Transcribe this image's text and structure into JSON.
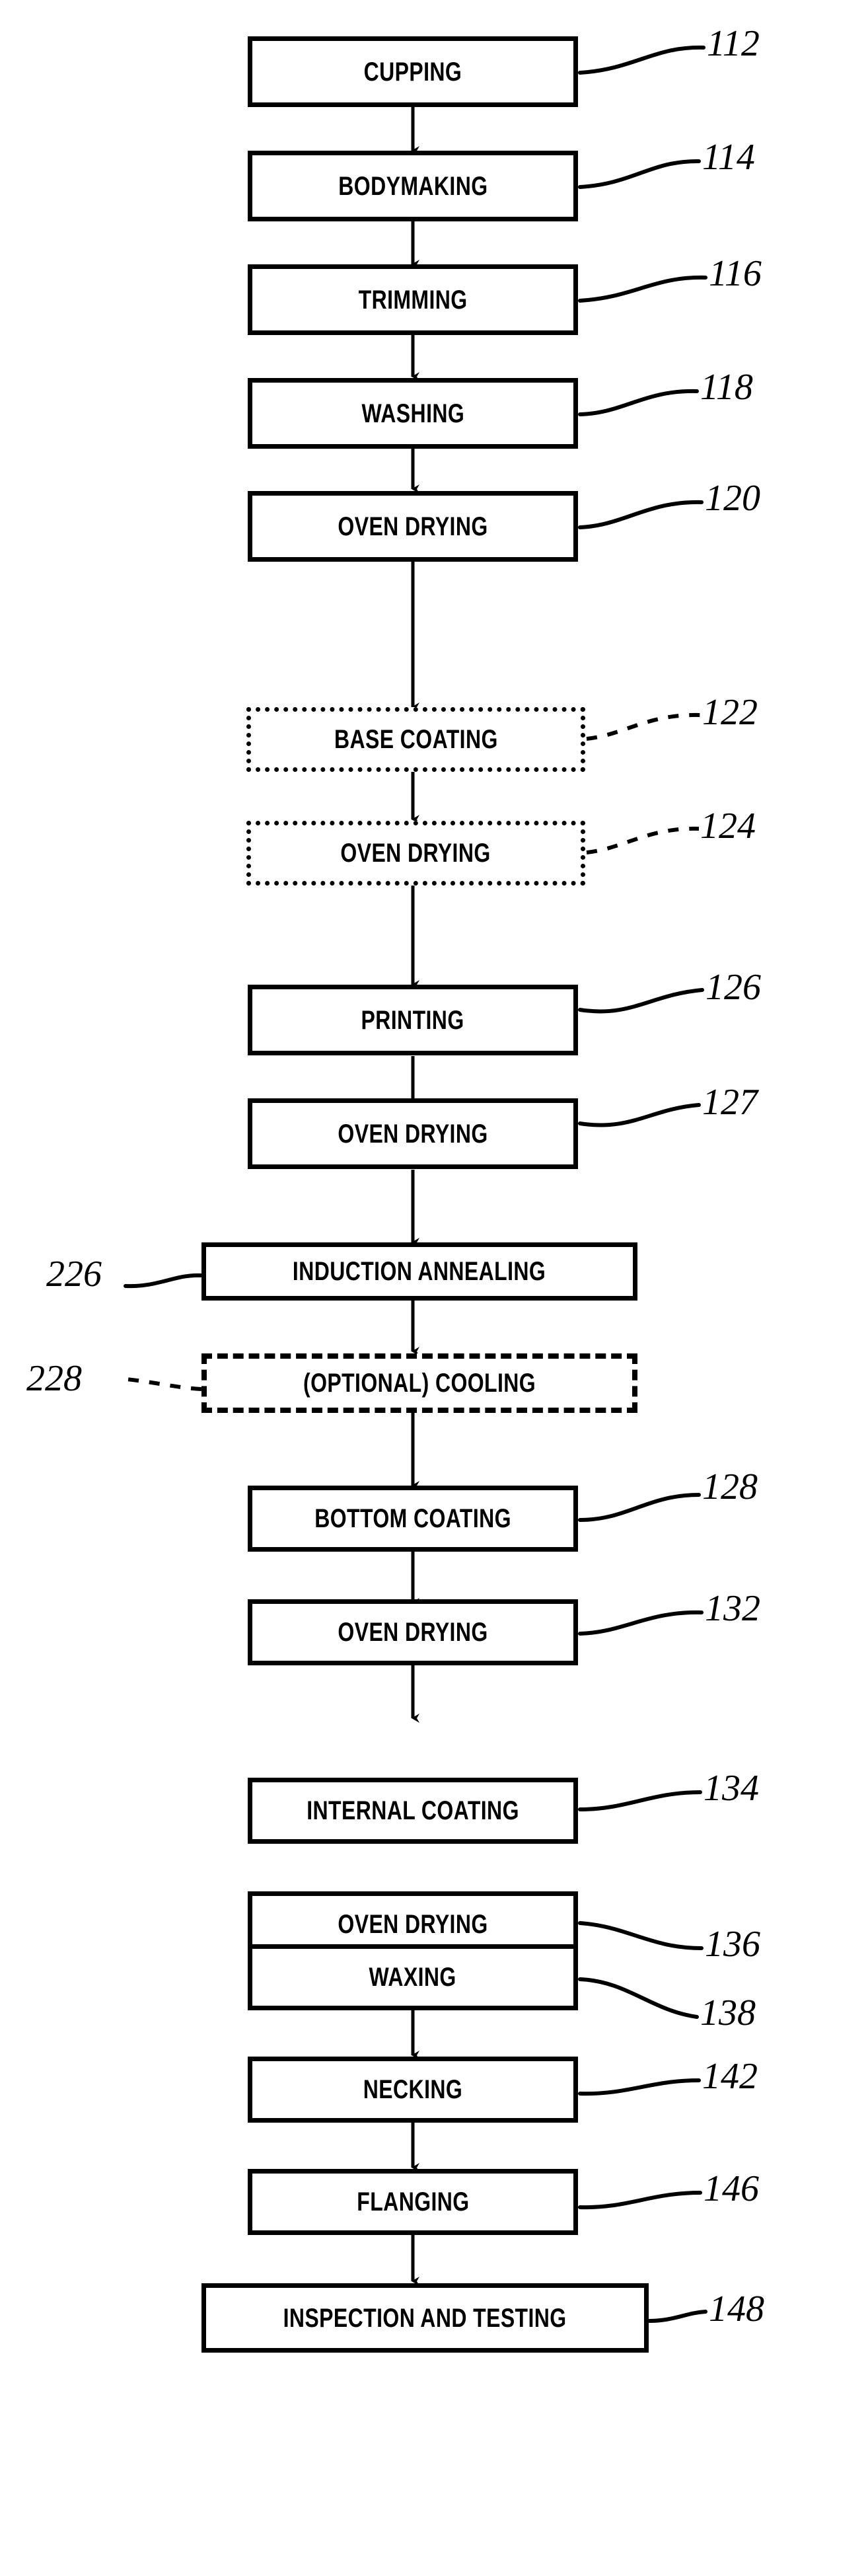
{
  "diagram": {
    "title": "Can manufacturing process flow chart",
    "orientation": "vertical top-to-bottom",
    "line_color": "#000000",
    "background_color": "#ffffff"
  },
  "nodes": [
    {
      "id": "n112",
      "label": "CUPPING",
      "ref": "112",
      "border": "solid",
      "ref_side": "right",
      "leader": "curve"
    },
    {
      "id": "n114",
      "label": "BODYMAKING",
      "ref": "114",
      "border": "solid",
      "ref_side": "right",
      "leader": "curve"
    },
    {
      "id": "n116",
      "label": "TRIMMING",
      "ref": "116",
      "border": "solid",
      "ref_side": "right",
      "leader": "curve"
    },
    {
      "id": "n118",
      "label": "WASHING",
      "ref": "118",
      "border": "solid",
      "ref_side": "right",
      "leader": "curve"
    },
    {
      "id": "n120",
      "label": "OVEN DRYING",
      "ref": "120",
      "border": "solid",
      "ref_side": "right",
      "leader": "curve"
    },
    {
      "id": "n122",
      "label": "BASE COATING",
      "ref": "122",
      "border": "dotted",
      "ref_side": "right",
      "leader": "dashed-curve"
    },
    {
      "id": "n124",
      "label": "OVEN DRYING",
      "ref": "124",
      "border": "dotted",
      "ref_side": "right",
      "leader": "dashed-curve"
    },
    {
      "id": "n126",
      "label": "PRINTING",
      "ref": "126",
      "border": "solid",
      "ref_side": "right",
      "leader": "curve"
    },
    {
      "id": "n127",
      "label": "OVEN DRYING",
      "ref": "127",
      "border": "solid",
      "ref_side": "right",
      "leader": "curve"
    },
    {
      "id": "n226",
      "label": "INDUCTION ANNEALING",
      "ref": "226",
      "border": "solid",
      "ref_side": "left",
      "leader": "curve"
    },
    {
      "id": "n228",
      "label": "(OPTIONAL) COOLING",
      "ref": "228",
      "border": "dashed",
      "ref_side": "left",
      "leader": "dashed-curve"
    },
    {
      "id": "n128",
      "label": "BOTTOM COATING",
      "ref": "128",
      "border": "solid",
      "ref_side": "right",
      "leader": "curve"
    },
    {
      "id": "n132",
      "label": "OVEN DRYING",
      "ref": "132",
      "border": "solid",
      "ref_side": "right",
      "leader": "curve"
    },
    {
      "id": "n134",
      "label": "INTERNAL COATING",
      "ref": "134",
      "border": "solid",
      "ref_side": "right",
      "leader": "curve"
    },
    {
      "id": "n136",
      "label": "OVEN DRYING",
      "ref": "136",
      "border": "solid",
      "ref_side": "right",
      "leader": "curve"
    },
    {
      "id": "n138",
      "label": "WAXING",
      "ref": "138",
      "border": "solid",
      "ref_side": "right",
      "leader": "curve"
    },
    {
      "id": "n142",
      "label": "NECKING",
      "ref": "142",
      "border": "solid",
      "ref_side": "right",
      "leader": "curve"
    },
    {
      "id": "n146",
      "label": "FLANGING",
      "ref": "146",
      "border": "solid",
      "ref_side": "right",
      "leader": "curve"
    },
    {
      "id": "n148",
      "label": "INSPECTION AND TESTING",
      "ref": "148",
      "border": "solid",
      "ref_side": "right",
      "leader": "curve"
    }
  ],
  "edges": [
    {
      "from": "n112",
      "to": "n114",
      "arrow": "down"
    },
    {
      "from": "n114",
      "to": "n116",
      "arrow": "down"
    },
    {
      "from": "n116",
      "to": "n118",
      "arrow": "down"
    },
    {
      "from": "n118",
      "to": "n120",
      "arrow": "down"
    },
    {
      "from": "n120",
      "to": "n122",
      "arrow": "down"
    },
    {
      "from": "n122",
      "to": "n124",
      "arrow": "down"
    },
    {
      "from": "n124",
      "to": "n126",
      "arrow": "down"
    },
    {
      "from": "n126",
      "to": "n127",
      "arrow": "down"
    },
    {
      "from": "n127",
      "to": "n226",
      "arrow": "down"
    },
    {
      "from": "n226",
      "to": "n228",
      "arrow": "down"
    },
    {
      "from": "n228",
      "to": "n128",
      "arrow": "down"
    },
    {
      "from": "n128",
      "to": "n132",
      "arrow": "down"
    },
    {
      "from": "n132",
      "to": "n134",
      "arrow": "down"
    },
    {
      "from": "n134",
      "to": "n136",
      "arrow": "down"
    },
    {
      "from": "n136",
      "to": "n138",
      "arrow": "down"
    },
    {
      "from": "n138",
      "to": "n142",
      "arrow": "down"
    },
    {
      "from": "n142",
      "to": "n146",
      "arrow": "down"
    },
    {
      "from": "n146",
      "to": "n148",
      "arrow": "down"
    }
  ]
}
